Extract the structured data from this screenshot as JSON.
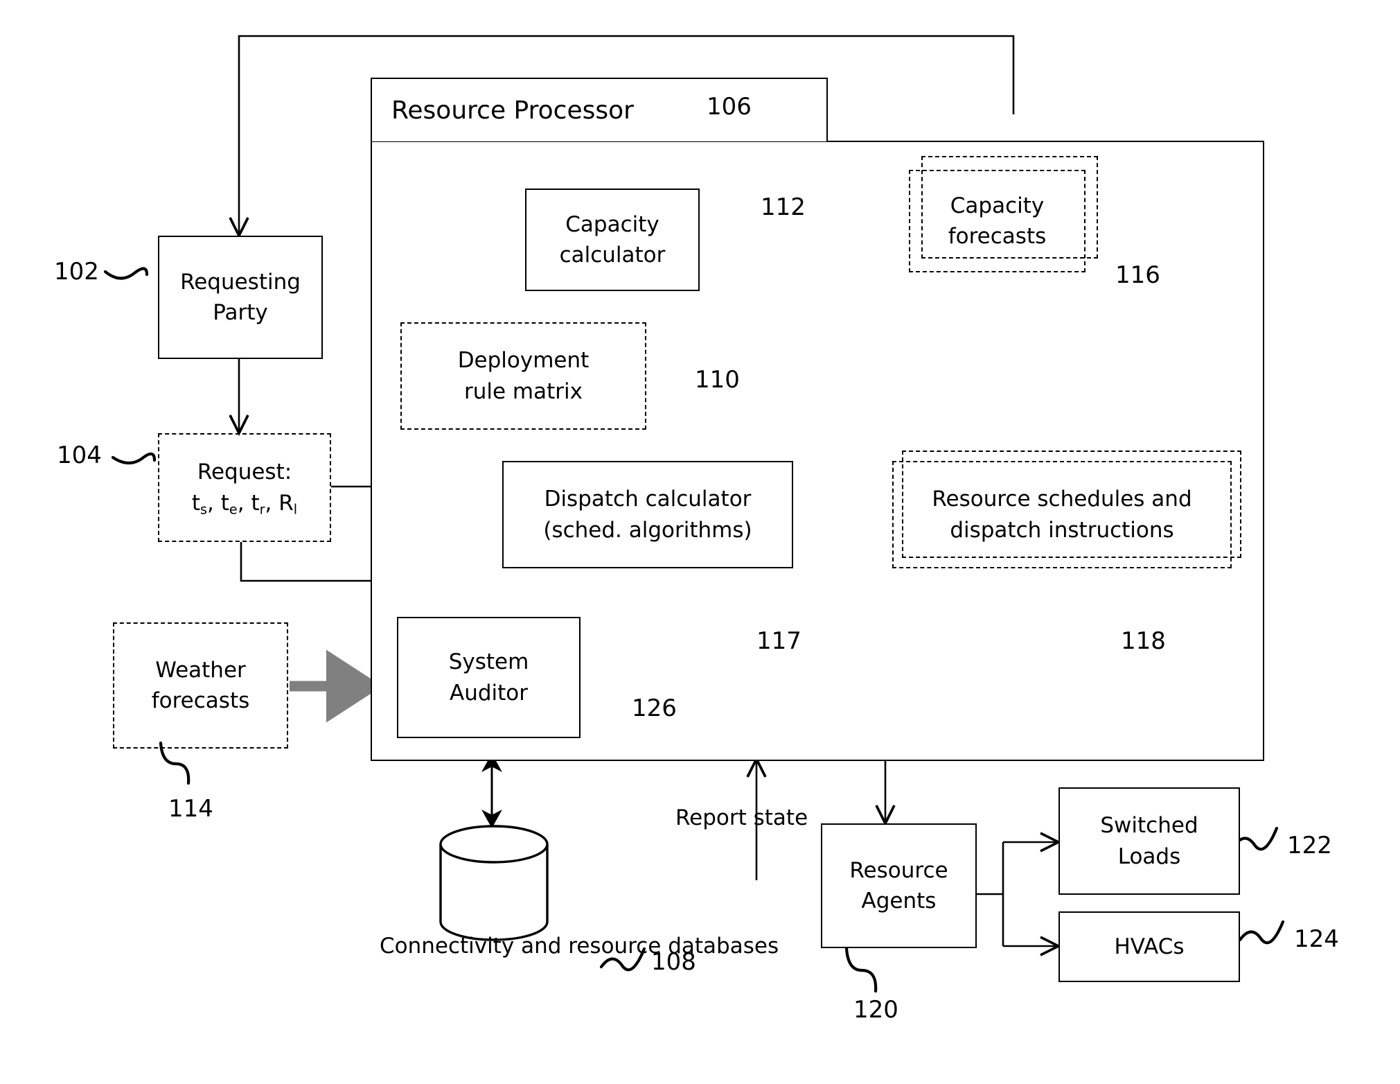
{
  "figure": {
    "type": "patent-system-block-diagram",
    "background": "#ffffff",
    "stroke": "#000000",
    "gray_arrow": "#808080"
  },
  "container": {
    "tab_label": "Resource Processor",
    "tab_ref": "106"
  },
  "nodes": {
    "requesting_party": {
      "line1": "Requesting",
      "line2": "Party",
      "ref": "102",
      "style": "solid"
    },
    "request": {
      "line1": "Request:",
      "line2_prefix": "t",
      "ref": "104",
      "style": "dashed",
      "params_plain": "ts, te, tr, Rl"
    },
    "weather_forecasts": {
      "line1": "Weather",
      "line2": "forecasts",
      "ref": "114",
      "style": "dashed"
    },
    "capacity_calculator": {
      "line1": "Capacity",
      "line2": "calculator",
      "ref": "112",
      "style": "solid"
    },
    "deployment_rule_matrix": {
      "line1": "Deployment",
      "line2": "rule matrix",
      "ref": "110",
      "style": "dashed"
    },
    "capacity_forecasts": {
      "line1": "Capacity",
      "line2": "forecasts",
      "ref": "116",
      "style": "dashed-stacked"
    },
    "dispatch_calculator": {
      "line1": "Dispatch calculator",
      "line2": "(sched. algorithms)",
      "ref": "117",
      "style": "solid"
    },
    "resource_schedules": {
      "line1": "Resource schedules and",
      "line2": "dispatch instructions",
      "ref": "118",
      "style": "dashed-stacked"
    },
    "system_auditor": {
      "line1": "System",
      "line2": "Auditor",
      "ref": "126",
      "style": "solid"
    },
    "databases": {
      "line1": "Connectivity and",
      "line2": "resource databases",
      "ref": "108",
      "style": "cylinder"
    },
    "resource_agents": {
      "line1": "Resource",
      "line2": "Agents",
      "ref": "120",
      "style": "solid"
    },
    "switched_loads": {
      "line1": "Switched",
      "line2": "Loads",
      "ref": "122",
      "style": "solid"
    },
    "hvacs": {
      "line1": "HVACs",
      "line2": "",
      "ref": "124",
      "style": "solid"
    }
  },
  "edge_labels": {
    "report_state_line1": "Report",
    "report_state_line2": "state"
  },
  "request_params": [
    {
      "base": "t",
      "sub": "s",
      "sep": ", "
    },
    {
      "base": "t",
      "sub": "e",
      "sep": ", "
    },
    {
      "base": "t",
      "sub": "r",
      "sep": ", "
    },
    {
      "base": "R",
      "sub": "l",
      "sep": ""
    }
  ]
}
